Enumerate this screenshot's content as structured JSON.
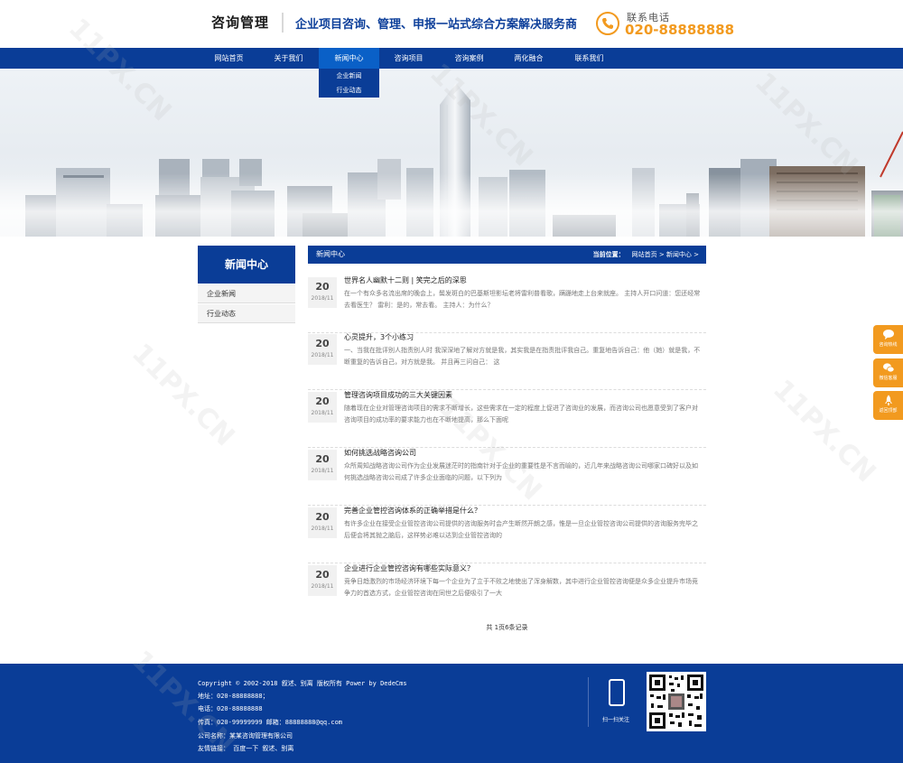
{
  "header": {
    "logo": "咨询管理",
    "slogan": "企业项目咨询、管理、申报一站式综合方案解决服务商",
    "phone_label": "联系电话",
    "phone_number": "020-88888888"
  },
  "nav": {
    "items": [
      "网站首页",
      "关于我们",
      "新闻中心",
      "咨询项目",
      "咨询案例",
      "两化融合",
      "联系我们"
    ],
    "active_index": 2,
    "dropdown": [
      "企业新闻",
      "行业动态"
    ]
  },
  "sidebar": {
    "title": "新闻中心",
    "items": [
      "企业新闻",
      "行业动态"
    ]
  },
  "main": {
    "section_title": "新闻中心",
    "breadcrumb_label": "当前位置：",
    "breadcrumb": "网站首页 > 新闻中心 >",
    "news": [
      {
        "day": "20",
        "ym": "2018/11",
        "title": "世界名人幽默十二则 | 笑完之后的深思",
        "desc": "在一个有众多名流出席的晚会上，鬓发斑白的巴基斯坦影坛老将雷利普看歌，蹒跚地走上台来就座。 主持人开口问道：您还经常去看医生？ 雷利：是的，常去看。 主持人：为什么？"
      },
      {
        "day": "20",
        "ym": "2018/11",
        "title": "心灵提升，3个小练习",
        "desc": "一、当我在批评别人指责别人时 我深深地了解对方就是我，其实我是在指责批评我自己。重复地告诉自己：他（她）就是我，不断重复的告诉自己，对方就是我。 并且再三问自己： 这"
      },
      {
        "day": "20",
        "ym": "2018/11",
        "title": "管理咨询项目成功的三大关键因素",
        "desc": "随着现在企业对管理咨询项目的需求不断增长，这些需求在一定的程度上促进了咨询业的发展，而咨询公司也愿意受到了客户对咨询项目的成功率的要求能力也在不断地提高，那么下面呢"
      },
      {
        "day": "20",
        "ym": "2018/11",
        "title": "如何挑选战略咨询公司",
        "desc": "众所周知战略咨询公司作为企业发展迷茫时的指南针对于企业的重要性是不言而喻的，近几年来战略咨询公司哪家口碑好以及如何挑选战略咨询公司成了许多企业面临的问题，以下列为"
      },
      {
        "day": "20",
        "ym": "2018/11",
        "title": "完善企业管控咨询体系的正确举措是什么？",
        "desc": "有许多企业在接受企业管控咨询公司提供的咨询服务时会产生断然开朗之感，惟是一旦企业管控咨询公司提供的咨询服务完毕之后便会将其抛之脑后，这样势必难以达到企业管控咨询的"
      },
      {
        "day": "20",
        "ym": "2018/11",
        "title": "企业进行企业管控咨询有哪些实际意义？",
        "desc": "竞争日趋激烈的市场经济环境下每一个企业为了立于不败之地使出了浑身解数，其中进行企业管控咨询便是众多企业提升市场竞争力的首选方式，企业管控咨询在同世之后便吸引了一大"
      }
    ],
    "pager": "共 1页6条记录"
  },
  "float": {
    "items": [
      "咨询热线",
      "微信客服",
      "返回顶部"
    ]
  },
  "footer": {
    "copyright": "Copyright © 2002-2018 叙述、别离 版权所有 Power by DedeCms",
    "address": "地址：020-88888888；",
    "phone": "电话：020-88888888",
    "fax_email": "传真：020-99999999   邮箱：88888888@qq.com",
    "company": "公司名称：某某咨询管理有限公司",
    "links": "友情链接：  百度一下  叙述、别离",
    "scan_label": "扫一扫关注"
  },
  "colors": {
    "primary": "#0a3d97",
    "accent": "#f29a1f",
    "active_nav": "#0a60c7"
  }
}
